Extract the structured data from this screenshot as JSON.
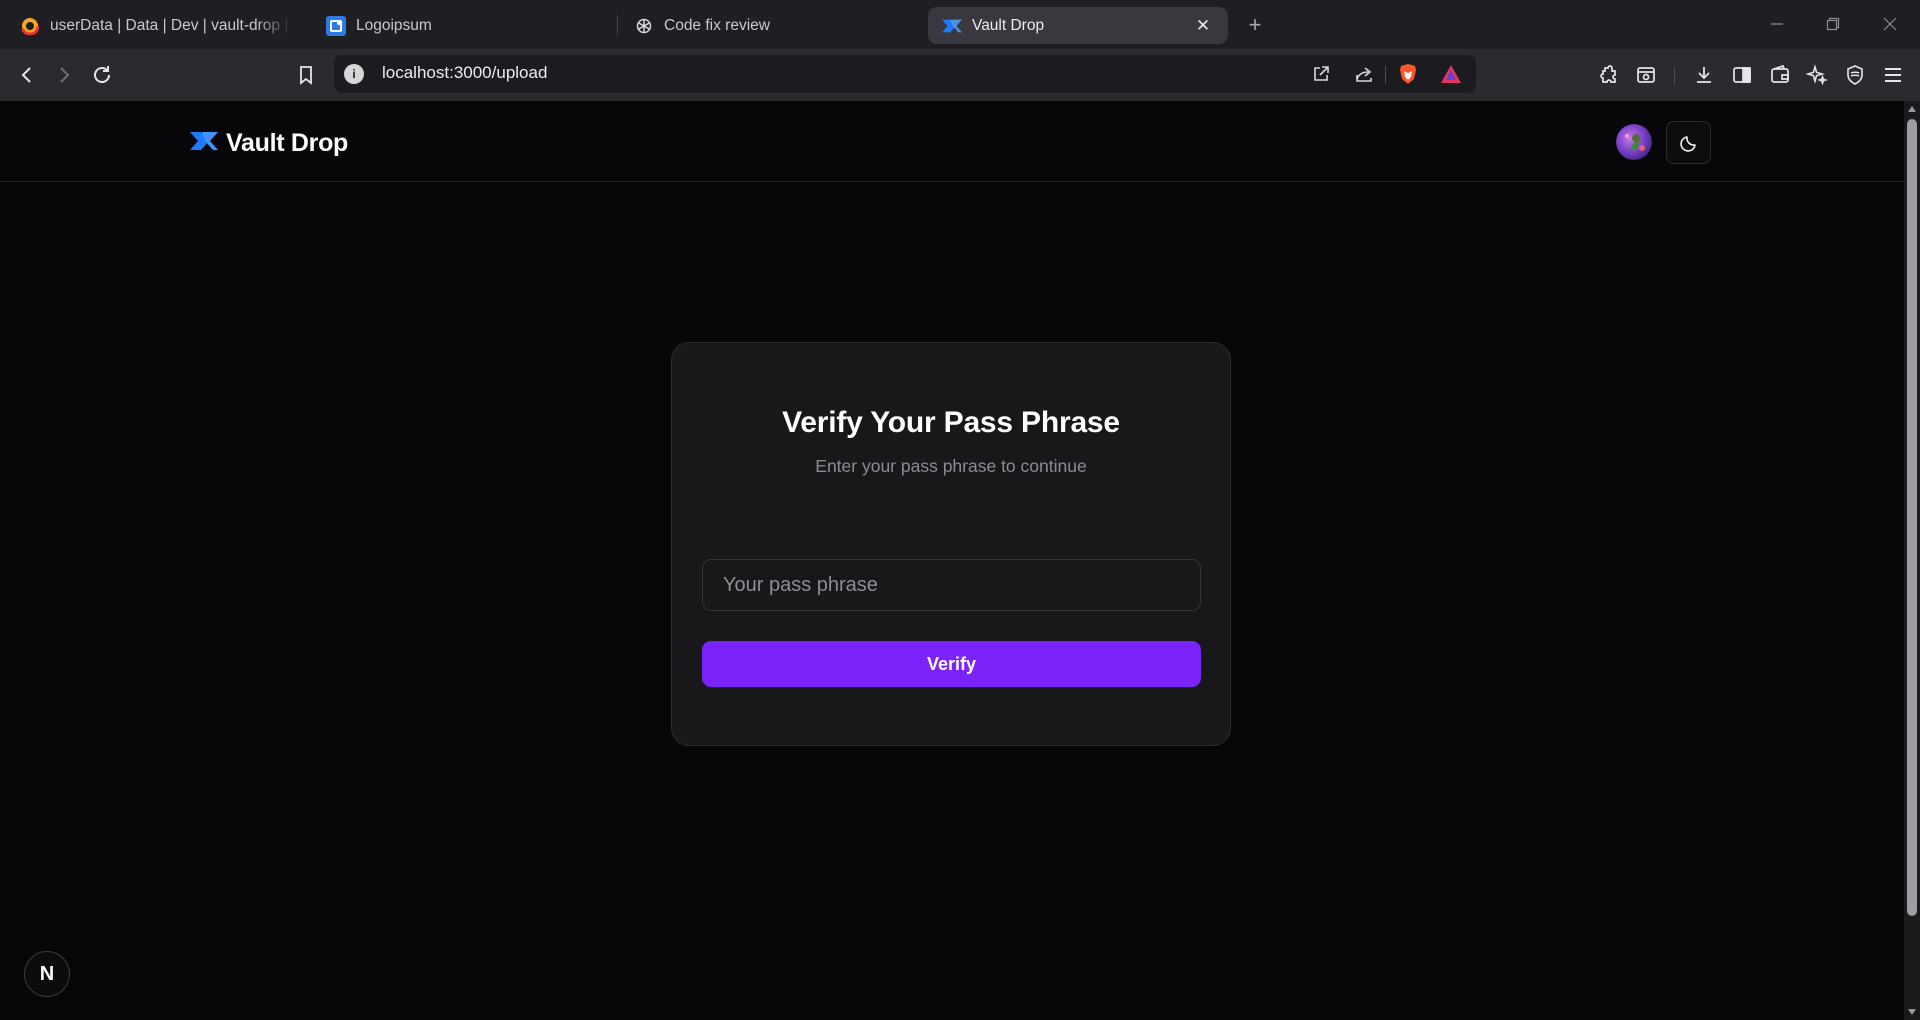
{
  "browser": {
    "tabs": [
      {
        "title": "userData | Data | Dev | vault-drop | Cl",
        "icon": "firebase-icon",
        "active": false
      },
      {
        "title": "Logoipsum",
        "icon": "logoipsum-icon",
        "active": false
      },
      {
        "title": "Code fix review",
        "icon": "openai-icon",
        "active": false
      },
      {
        "title": "Vault Drop",
        "icon": "vault-drop-icon",
        "active": true
      }
    ],
    "close_glyph": "✕",
    "new_tab_glyph": "+",
    "url": "localhost:3000/upload",
    "info_glyph": "i"
  },
  "site": {
    "brand": "Vault Drop",
    "accent": "#7c22fb",
    "brand_color": "#1e7bff"
  },
  "verify": {
    "title": "Verify Your Pass Phrase",
    "subtitle": "Enter your pass phrase to continue",
    "placeholder": "Your pass phrase",
    "value": "",
    "button": "Verify"
  },
  "dev_badge": "N"
}
